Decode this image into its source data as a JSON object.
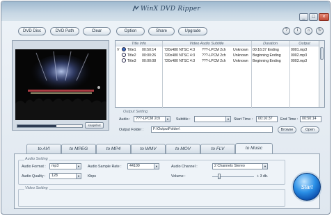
{
  "app": {
    "title": "WinX DVD Ripper"
  },
  "window_buttons": {
    "minimize": "_",
    "maximize": "□",
    "close": "×"
  },
  "toolbar": {
    "buttons": [
      {
        "label": "DVD Disc"
      },
      {
        "label": "DVD Path"
      },
      {
        "label": "Clear"
      },
      {
        "label": "Option"
      },
      {
        "label": "Share"
      },
      {
        "label": "Upgrade"
      }
    ],
    "icons": [
      {
        "name": "help-icon",
        "glyph": "?"
      },
      {
        "name": "info-icon",
        "glyph": "i"
      },
      {
        "name": "home-icon",
        "glyph": "⌂"
      },
      {
        "name": "update-icon",
        "glyph": "↻"
      }
    ]
  },
  "preview": {
    "snapshot_label": "snapshot",
    "progress": 0.6
  },
  "titles": {
    "columns": [
      "Title Info",
      "Video Audio Subtitle",
      "Duration",
      "Output"
    ],
    "rows": [
      {
        "mark": "V",
        "title": "Title1",
        "length": "00:50:14",
        "video": "720x480 NTSC 4:3",
        "audio": "???-LPCM 2ch",
        "subtitle": "Unknown",
        "duration": "00:16:37 Ending",
        "output": "0001.mp3"
      },
      {
        "mark": "",
        "title": "Title2",
        "length": "00:00:26",
        "video": "720x480 NTSC 4:3",
        "audio": "???-LPCM 2ch",
        "subtitle": "Unknown",
        "duration": "Beginning Ending",
        "output": "0002.mp3"
      },
      {
        "mark": "",
        "title": "Title3",
        "length": "00:00:08",
        "video": "720x480 NTSC 4:3",
        "audio": "???-LPCM 2ch",
        "subtitle": "Unknown",
        "duration": "Beginning Ending",
        "output": "0003.mp3"
      }
    ]
  },
  "output_setting": {
    "legend": "Output Setting",
    "audio_label": "Audio :",
    "audio_value": "???-LPCM 2ch",
    "subtitle_label": "Subtitle :",
    "subtitle_value": "",
    "start_time_label": "Start Time :",
    "start_time_value": "00:16:37",
    "end_time_label": "End Time :",
    "end_time_value": "00:50:14",
    "folder_label": "Output Folder :",
    "folder_value": "F:\\OutputFolder\\",
    "browse_label": "Browse",
    "open_label": "Open"
  },
  "tabs": [
    {
      "label": "to AVI"
    },
    {
      "label": "to MPEG"
    },
    {
      "label": "to MP4"
    },
    {
      "label": "to WMV"
    },
    {
      "label": "to MOV"
    },
    {
      "label": "to FLV"
    },
    {
      "label": "to Music",
      "active": true
    }
  ],
  "audio_setting": {
    "legend": "Audio Setting",
    "format_label": "Audio Format :",
    "format_value": "mp3",
    "quality_label": "Audio Quality :",
    "quality_value": "128",
    "quality_unit": "Kbps",
    "sample_rate_label": "Audio Sample Rate :",
    "sample_rate_value": "44100",
    "channel_label": "Audio Channel :",
    "channel_value": "2 Channels Stereo",
    "volume_label": "Volume :",
    "volume_value": "+ 3 db.",
    "volume_level": 0.15
  },
  "video_setting": {
    "legend": "Video Setting"
  },
  "start_button": {
    "label": "Start"
  },
  "colors": {
    "accent": "#2a8fe6",
    "frame": "#dfe7ef"
  }
}
